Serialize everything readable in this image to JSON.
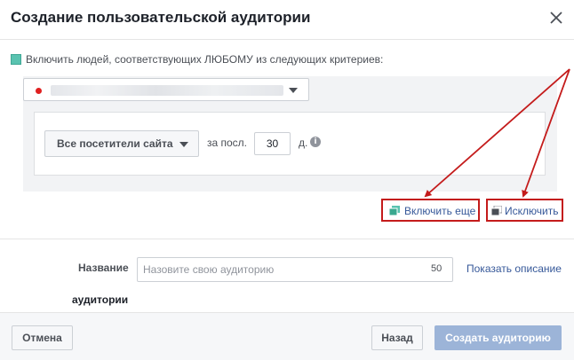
{
  "dialog": {
    "title": "Создание пользовательской аудитории"
  },
  "criteria": {
    "include_text": "Включить людей, соответствующих ЛЮБОМУ из следующих критериев:",
    "rule": {
      "visitors_label": "Все посетители сайта",
      "last_label": "за посл.",
      "days_value": "30",
      "days_unit": "д.",
      "info_glyph": "i"
    }
  },
  "actions": {
    "include_more_label": "Включить еще",
    "exclude_label": "Исключить"
  },
  "name_section": {
    "label_line1": "Название",
    "label_line2": "аудитории",
    "placeholder": "Назовите свою аудиторию",
    "char_count": "50",
    "show_description": "Показать описание"
  },
  "footer": {
    "cancel_label": "Отмена",
    "back_label": "Назад",
    "create_label": "Создать аудиторию"
  },
  "colors": {
    "accent_link": "#365899",
    "annotation_red": "#c41b1b",
    "checkbox_teal": "#5ac3b0",
    "disabled_primary": "#9cb4d8"
  },
  "icons": {
    "close": "close-icon",
    "dropdown": "chevron-down-icon",
    "info": "info-icon",
    "include": "include-copy-icon",
    "exclude": "exclude-copy-icon"
  }
}
